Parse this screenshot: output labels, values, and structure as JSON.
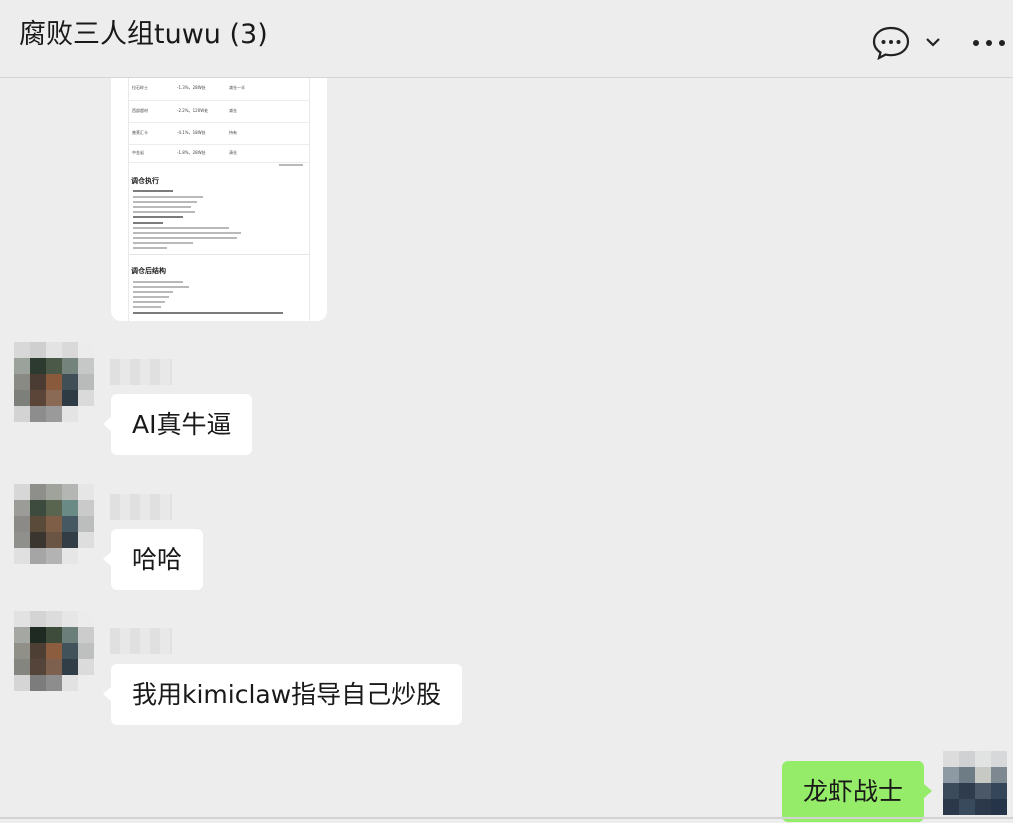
{
  "header": {
    "title": "腐败三人组tuwu (3)",
    "icons": [
      "chat-bubble-icon",
      "chevron-down-icon",
      "more-icon"
    ]
  },
  "image_message": {
    "table_rows": [
      {
        "c1": "拉石岭士",
        "c2": "-1.3%，28W处",
        "c3": "减仓一半",
        "c4": "前行高波段点更美体"
      },
      {
        "c1": "西部超材",
        "c2": "-2.2%，120W处",
        "c3": "减仓",
        "c4": "小额收益逆转，降低"
      },
      {
        "c1": "普莱汇卡",
        "c2": "-4.1%，18W处",
        "c3": "持有",
        "c4": "退税资产，保持中期"
      },
      {
        "c1": "中金岩",
        "c2": "-1.8%，28W处",
        "c3": "清仓",
        "c4": "停半空，占有现金"
      }
    ],
    "section1": "调仓执行",
    "section2": "调仓后结构"
  },
  "messages": [
    {
      "text": "AI真牛逼",
      "from": "other"
    },
    {
      "text": "哈哈",
      "from": "other"
    },
    {
      "text": "我用kimiclaw指导自己炒股",
      "from": "other"
    },
    {
      "text": "龙虾战士",
      "from": "me"
    }
  ],
  "colors": {
    "background": "#ededed",
    "bubble_other": "#ffffff",
    "bubble_me": "#95ec69"
  }
}
